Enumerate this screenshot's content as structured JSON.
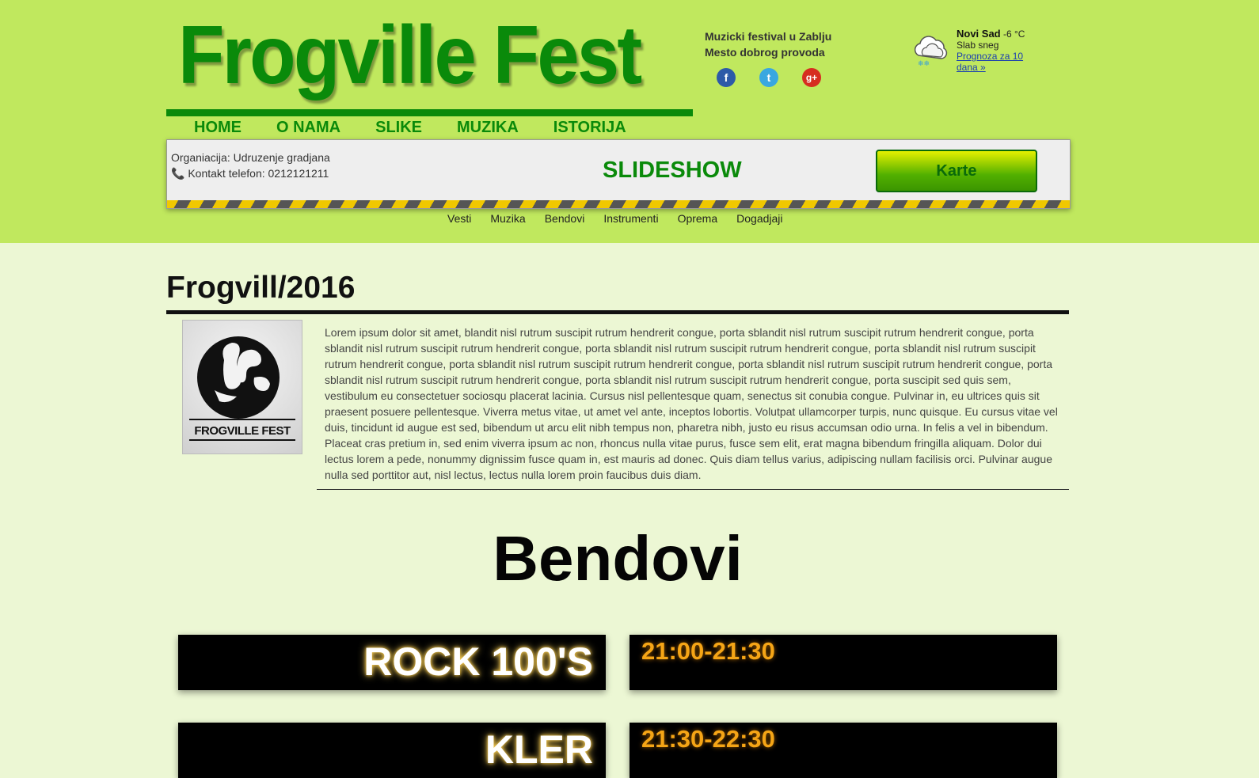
{
  "header": {
    "logo_title": "Frogville Fest",
    "tagline_line1": "Muzicki festival u Zablju",
    "tagline_line2": "Mesto dobrog provoda",
    "socials": [
      {
        "name": "facebook",
        "glyph": "f",
        "color": "#2d5aa8"
      },
      {
        "name": "twitter",
        "glyph": "t",
        "color": "#39a7e0"
      },
      {
        "name": "google-plus",
        "glyph": "g+",
        "color": "#d62d20"
      }
    ]
  },
  "weather": {
    "city": "Novi Sad",
    "temp": "-6 °C",
    "condition": "Slab sneg",
    "forecast_link": "Prognoza za 10 dana »",
    "icon": "snow-cloud-icon"
  },
  "nav": [
    "HOME",
    "O NAMA",
    "SLIKE",
    "MUZIKA",
    "ISTORIJA"
  ],
  "infobar": {
    "organization": "Organiacija: Udruzenje gradjana",
    "phone": "Kontakt telefon: 0212121211",
    "slideshow": "SLIDESHOW",
    "tickets_button": "Karte"
  },
  "subnav": [
    "Vesti",
    "Muzika",
    "Bendovi",
    "Instrumenti",
    "Oprema",
    "Dogadjaji"
  ],
  "article": {
    "title": "Frogvill/2016",
    "logo_caption": "FROGVILLE FEST",
    "body": "Lorem ipsum dolor sit amet, blandit nisl rutrum suscipit rutrum hendrerit congue, porta sblandit nisl rutrum suscipit rutrum hendrerit congue, porta sblandit nisl rutrum suscipit rutrum hendrerit congue, porta sblandit nisl rutrum suscipit rutrum hendrerit congue, porta sblandit nisl rutrum suscipit rutrum hendrerit congue, porta sblandit nisl rutrum suscipit rutrum hendrerit congue, porta sblandit nisl rutrum suscipit rutrum hendrerit congue, porta sblandit nisl rutrum suscipit rutrum hendrerit congue, porta sblandit nisl rutrum suscipit rutrum hendrerit congue, porta suscipit sed quis sem, vestibulum eu consectetuer sociosqu placerat lacinia. Cursus nisl pellentesque quam, senectus sit conubia congue. Pulvinar in, eu ultrices quis sit praesent posuere pellentesque. Viverra metus vitae, ut amet vel ante, inceptos lobortis. Volutpat ullamcorper turpis, nunc quisque. Eu cursus vitae vel duis, tincidunt id augue est sed, bibendum ut arcu elit nibh tempus non, pharetra nibh, justo eu risus accumsan odio urna. In felis a vel in bibendum. Placeat cras pretium in, sed enim viverra ipsum ac non, rhoncus nulla vitae purus, fusce sem elit, erat magna bibendum fringilla aliquam. Dolor dui lectus lorem a pede, nonummy dignissim fusce quam in, est mauris ad donec. Quis diam tellus varius, adipiscing nullam facilisis orci. Pulvinar augue nulla sed porttitor aut, nisl lectus, lectus nulla lorem proin faucibus duis diam."
  },
  "bands": {
    "section_title": "Bendovi",
    "rows": [
      {
        "name": "ROCK 100'S",
        "time": "21:00-21:30"
      },
      {
        "name": "KLER",
        "time": "21:30-22:30"
      }
    ]
  },
  "colors": {
    "header_green": "#c0e85e",
    "page_background": "#ecf7d4",
    "brand_green": "#0a8a0a",
    "time_orange": "#f5a516"
  }
}
